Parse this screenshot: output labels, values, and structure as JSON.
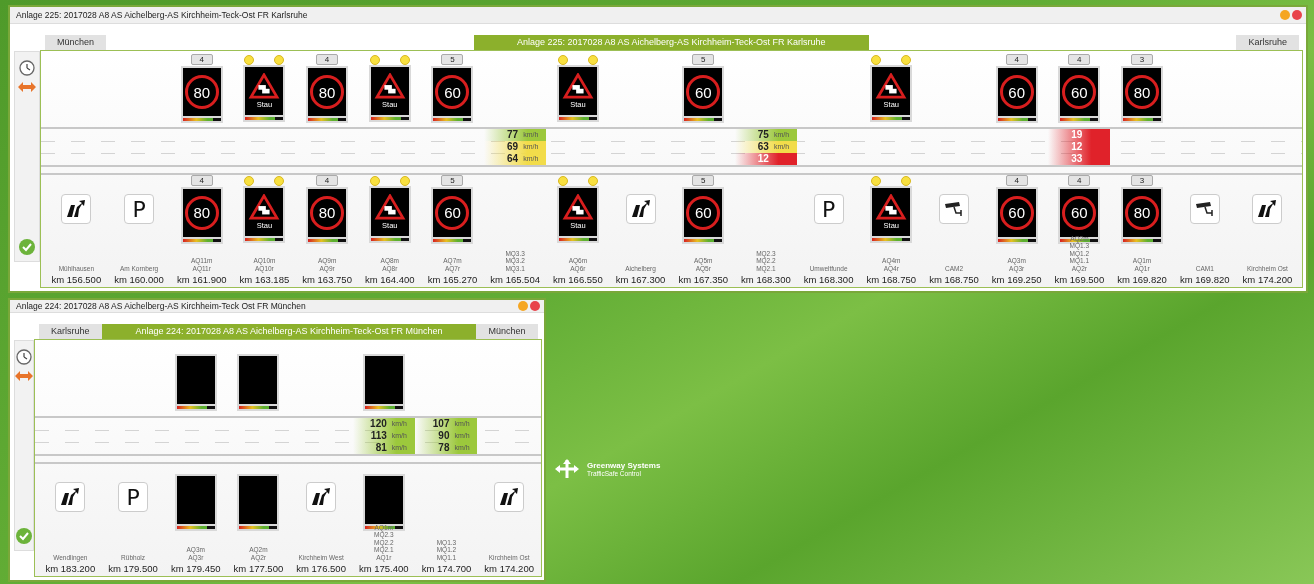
{
  "windows": [
    {
      "title": "Anlage 225: 2017028 A8 AS Aichelberg-AS Kirchheim-Teck-Ost FR Karlsruhe",
      "header": [
        {
          "kind": "direction",
          "label": "München"
        },
        {
          "kind": "title",
          "label": "Anlage 225: 2017028 A8 AS Aichelberg-AS Kirchheim-Teck-Ost FR Karlsruhe"
        },
        {
          "kind": "direction",
          "label": "Karlsruhe"
        }
      ],
      "stations": [
        {
          "bottom": {
            "kind": "exit"
          },
          "labels": [
            "Mühlhausen"
          ],
          "km": "km 156.500"
        },
        {
          "bottom": {
            "kind": "parking",
            "text": "P"
          },
          "labels": [
            "Am Kornberg"
          ],
          "km": "km 160.000"
        },
        {
          "top": {
            "kind": "speed_limit",
            "tab": "4",
            "value": "80"
          },
          "bottom": {
            "kind": "speed_limit",
            "tab": "4",
            "value": "80"
          },
          "labels": [
            "AQ11m",
            "AQ11r"
          ],
          "km": "km 161.900"
        },
        {
          "top": {
            "kind": "warning",
            "text": "Stau"
          },
          "bottom": {
            "kind": "warning",
            "text": "Stau"
          },
          "labels": [
            "AQ10m",
            "AQ10r"
          ],
          "km": "km 163.185"
        },
        {
          "top": {
            "kind": "speed_limit",
            "tab": "4",
            "value": "80"
          },
          "bottom": {
            "kind": "speed_limit",
            "tab": "4",
            "value": "80"
          },
          "labels": [
            "AQ9m",
            "AQ9r"
          ],
          "km": "km 163.750"
        },
        {
          "top": {
            "kind": "warning",
            "text": "Stau"
          },
          "bottom": {
            "kind": "warning",
            "text": "Stau"
          },
          "labels": [
            "AQ8m",
            "AQ8r"
          ],
          "km": "km 164.400"
        },
        {
          "top": {
            "kind": "speed_limit",
            "tab": "5",
            "value": "60"
          },
          "bottom": {
            "kind": "speed_limit",
            "tab": "5",
            "value": "60"
          },
          "labels": [
            "AQ7m",
            "AQ7r"
          ],
          "km": "km 165.270"
        },
        {
          "speeds": [
            {
              "value": "77",
              "unit": "km/h",
              "color": "#9cc83c"
            },
            {
              "value": "69",
              "unit": "km/h",
              "color": "#f2dc4a"
            },
            {
              "value": "64",
              "unit": "km/h",
              "color": "#f2dc4a"
            }
          ],
          "labels": [
            "MQ3.3",
            "MQ3.2",
            "MQ3.1"
          ],
          "km": "km 165.504"
        },
        {
          "top": {
            "kind": "warning",
            "text": "Stau"
          },
          "bottom": {
            "kind": "warning",
            "text": "Stau"
          },
          "labels": [
            "AQ6m",
            "AQ6r"
          ],
          "km": "km 166.550"
        },
        {
          "bottom": {
            "kind": "exit"
          },
          "labels": [
            "Aichelberg"
          ],
          "km": "km 167.300"
        },
        {
          "top": {
            "kind": "speed_limit",
            "tab": "5",
            "value": "60"
          },
          "bottom": {
            "kind": "speed_limit",
            "tab": "5",
            "value": "60"
          },
          "labels": [
            "AQ5m",
            "AQ5r"
          ],
          "km": "km 167.350"
        },
        {
          "speeds": [
            {
              "value": "75",
              "unit": "km/h",
              "color": "#9cc83c"
            },
            {
              "value": "63",
              "unit": "km/h",
              "color": "#f2dc4a"
            },
            {
              "value": "12",
              "color": "#e0222a"
            }
          ],
          "labels": [
            "MQ2.3",
            "MQ2.2",
            "MQ2.1"
          ],
          "km": "km 168.300"
        },
        {
          "bottom": {
            "kind": "parking",
            "text": "P"
          },
          "labels": [
            "Umweltfunde"
          ],
          "km": "km 168.300"
        },
        {
          "top": {
            "kind": "warning",
            "text": "Stau"
          },
          "bottom": {
            "kind": "warning",
            "text": "Stau"
          },
          "labels": [
            "AQ4m",
            "AQ4r"
          ],
          "km": "km 168.750"
        },
        {
          "bottom": {
            "kind": "camera"
          },
          "labels": [
            "CAM2"
          ],
          "km": "km 168.750"
        },
        {
          "top": {
            "kind": "speed_limit",
            "tab": "4",
            "value": "60"
          },
          "bottom": {
            "kind": "speed_limit",
            "tab": "4",
            "value": "60"
          },
          "labels": [
            "AQ3m",
            "AQ3r"
          ],
          "km": "km 169.250"
        },
        {
          "top": {
            "kind": "speed_limit",
            "tab": "4",
            "value": "60"
          },
          "speeds": [
            {
              "value": "19",
              "color": "#e0222a"
            },
            {
              "value": "12",
              "color": "#e0222a"
            },
            {
              "value": "33",
              "color": "#e0222a"
            }
          ],
          "bottom": {
            "kind": "speed_limit",
            "tab": "4",
            "value": "60"
          },
          "labels": [
            "AQ2m",
            "MQ1.3",
            "MQ1.2",
            "MQ1.1",
            "AQ2r"
          ],
          "km": "km 169.500"
        },
        {
          "top": {
            "kind": "speed_limit",
            "tab": "3",
            "value": "80"
          },
          "bottom": {
            "kind": "speed_limit",
            "tab": "3",
            "value": "80"
          },
          "labels": [
            "AQ1m",
            "AQ1r"
          ],
          "km": "km 169.820"
        },
        {
          "bottom": {
            "kind": "camera"
          },
          "labels": [
            "CAM1"
          ],
          "km": "km 169.820"
        },
        {
          "bottom": {
            "kind": "exit"
          },
          "labels": [
            "Kirchheim Ost"
          ],
          "km": "km 174.200"
        }
      ]
    },
    {
      "title": "Anlage 224: 2017028 A8 AS Aichelberg-AS Kirchheim-Teck Ost FR München",
      "header": [
        {
          "kind": "direction",
          "label": "Karlsruhe"
        },
        {
          "kind": "title",
          "label": "Anlage 224: 2017028 A8 AS Aichelberg-AS Kirchheim-Teck-Ost FR München"
        },
        {
          "kind": "direction",
          "label": "München"
        }
      ],
      "stations": [
        {
          "bottom": {
            "kind": "exit"
          },
          "labels": [
            "Wendlingen"
          ],
          "km": "km 183.200"
        },
        {
          "bottom": {
            "kind": "parking",
            "text": "P"
          },
          "labels": [
            "Rübholz"
          ],
          "km": "km 179.500"
        },
        {
          "top": {
            "kind": "blank"
          },
          "bottom": {
            "kind": "blank"
          },
          "labels": [
            "AQ3m",
            "AQ3r"
          ],
          "km": "km 179.450"
        },
        {
          "top": {
            "kind": "blank"
          },
          "bottom": {
            "kind": "blank"
          },
          "labels": [
            "AQ2m",
            "AQ2r"
          ],
          "km": "km 177.500"
        },
        {
          "bottom": {
            "kind": "exit"
          },
          "labels": [
            "Kirchheim West"
          ],
          "km": "km 176.500"
        },
        {
          "top": {
            "kind": "blank"
          },
          "speeds": [
            {
              "value": "120",
              "unit": "km/h",
              "color": "#9cc83c"
            },
            {
              "value": "113",
              "unit": "km/h",
              "color": "#9cc83c"
            },
            {
              "value": "81",
              "unit": "km/h",
              "color": "#9cc83c"
            }
          ],
          "bottom": {
            "kind": "blank"
          },
          "labels": [
            "AQ1m",
            "MQ2.3",
            "MQ2.2",
            "MQ2.1",
            "AQ1r"
          ],
          "km": "km 175.400"
        },
        {
          "speeds": [
            {
              "value": "107",
              "unit": "km/h",
              "color": "#9cc83c"
            },
            {
              "value": "90",
              "unit": "km/h",
              "color": "#9cc83c"
            },
            {
              "value": "78",
              "unit": "km/h",
              "color": "#9cc83c"
            }
          ],
          "labels": [
            "MQ1.3",
            "MQ1.2",
            "MQ1.1"
          ],
          "km": "km 174.700"
        },
        {
          "bottom": {
            "kind": "exit"
          },
          "labels": [
            "Kirchheim Ost"
          ],
          "km": "km 174.200"
        }
      ]
    }
  ],
  "logo": {
    "name": "Greenway Systems",
    "subtitle": "TrafficSafe Control"
  }
}
